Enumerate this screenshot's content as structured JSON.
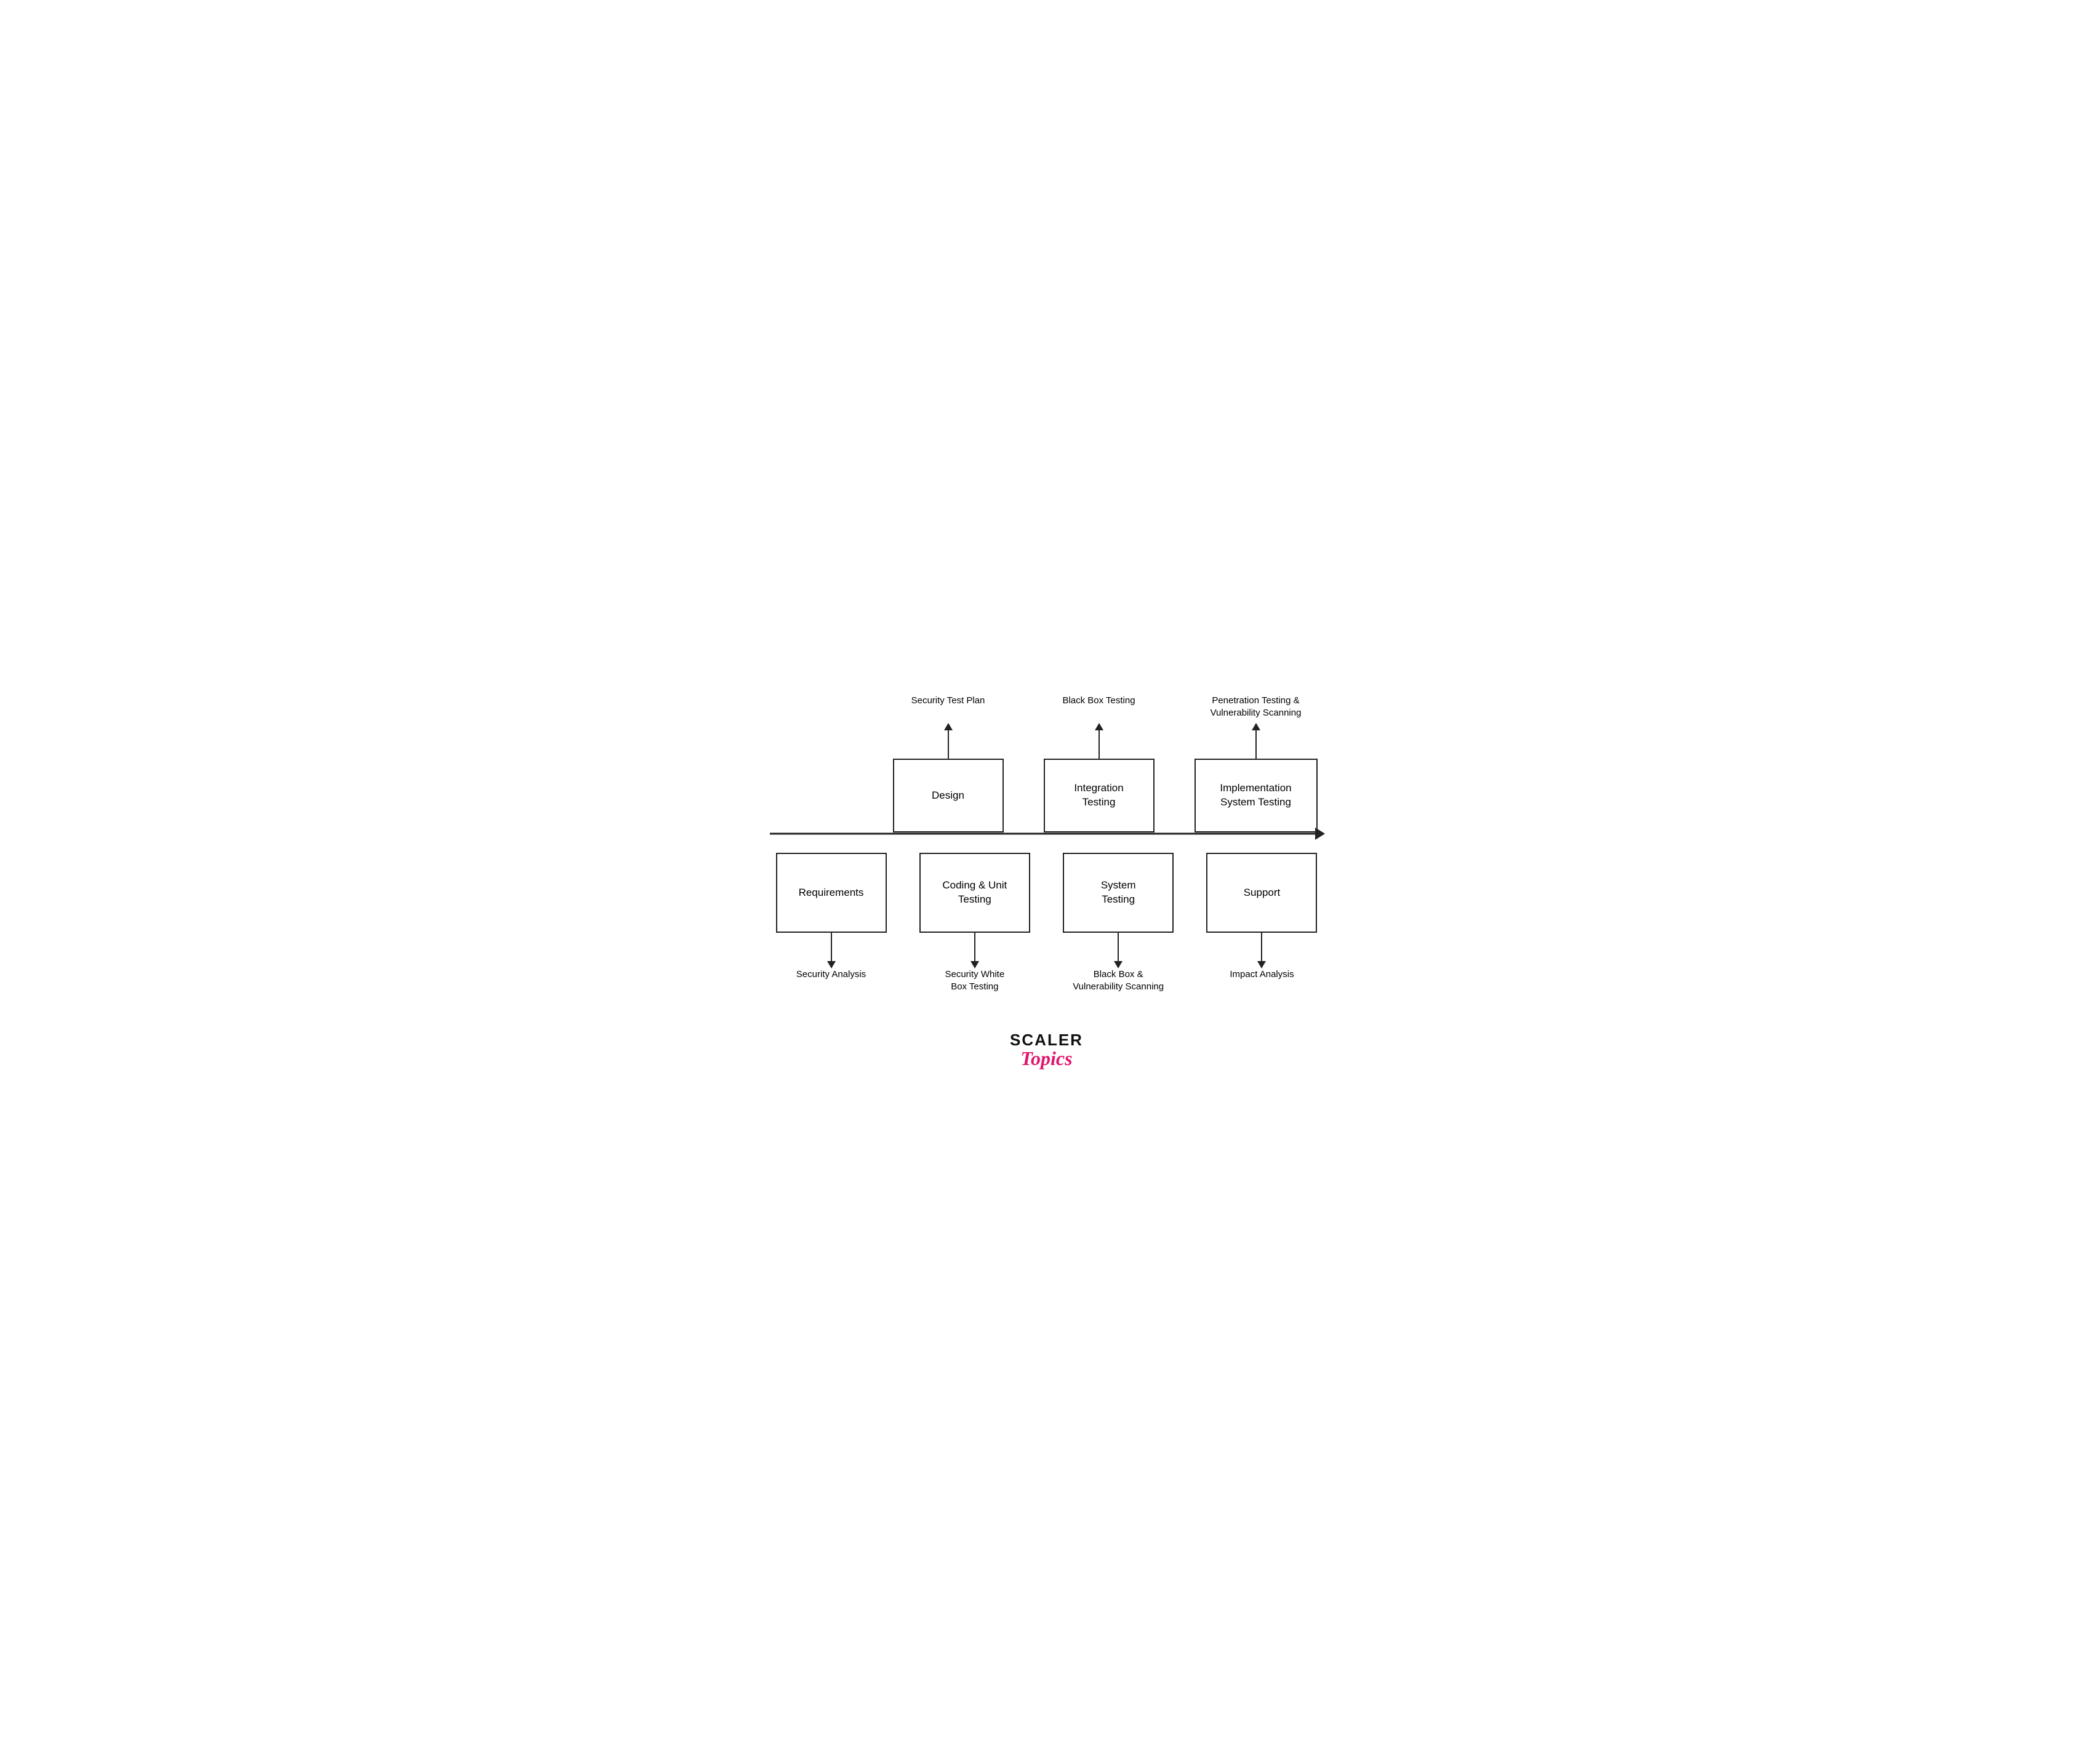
{
  "top_labels": [
    {
      "id": "security-test-plan-label",
      "text": "Security Test Plan"
    },
    {
      "id": "black-box-testing-label",
      "text": "Black Box Testing"
    },
    {
      "id": "penetration-testing-label",
      "text": "Penetration Testing &\nVulnerability Scanning"
    }
  ],
  "top_boxes": [
    {
      "id": "design-box",
      "text": "Design"
    },
    {
      "id": "integration-testing-box",
      "text": "Integration\nTesting"
    },
    {
      "id": "implementation-system-testing-box",
      "text": "Implementation\nSystem Testing"
    }
  ],
  "bottom_boxes": [
    {
      "id": "requirements-box",
      "text": "Requirements"
    },
    {
      "id": "coding-unit-testing-box",
      "text": "Coding & Unit\nTesting"
    },
    {
      "id": "system-testing-box",
      "text": "System\nTesting"
    },
    {
      "id": "support-box",
      "text": "Support"
    }
  ],
  "bottom_labels": [
    {
      "id": "security-analysis-label",
      "text": "Security Analysis"
    },
    {
      "id": "security-white-box-testing-label",
      "text": "Security White\nBox Testing"
    },
    {
      "id": "black-box-vulnerability-scanning-label",
      "text": "Black Box &\nVulnerability Scanning"
    },
    {
      "id": "impact-analysis-label",
      "text": "Impact Analysis"
    }
  ],
  "logo": {
    "scaler": "SCALER",
    "topics": "Topics"
  }
}
